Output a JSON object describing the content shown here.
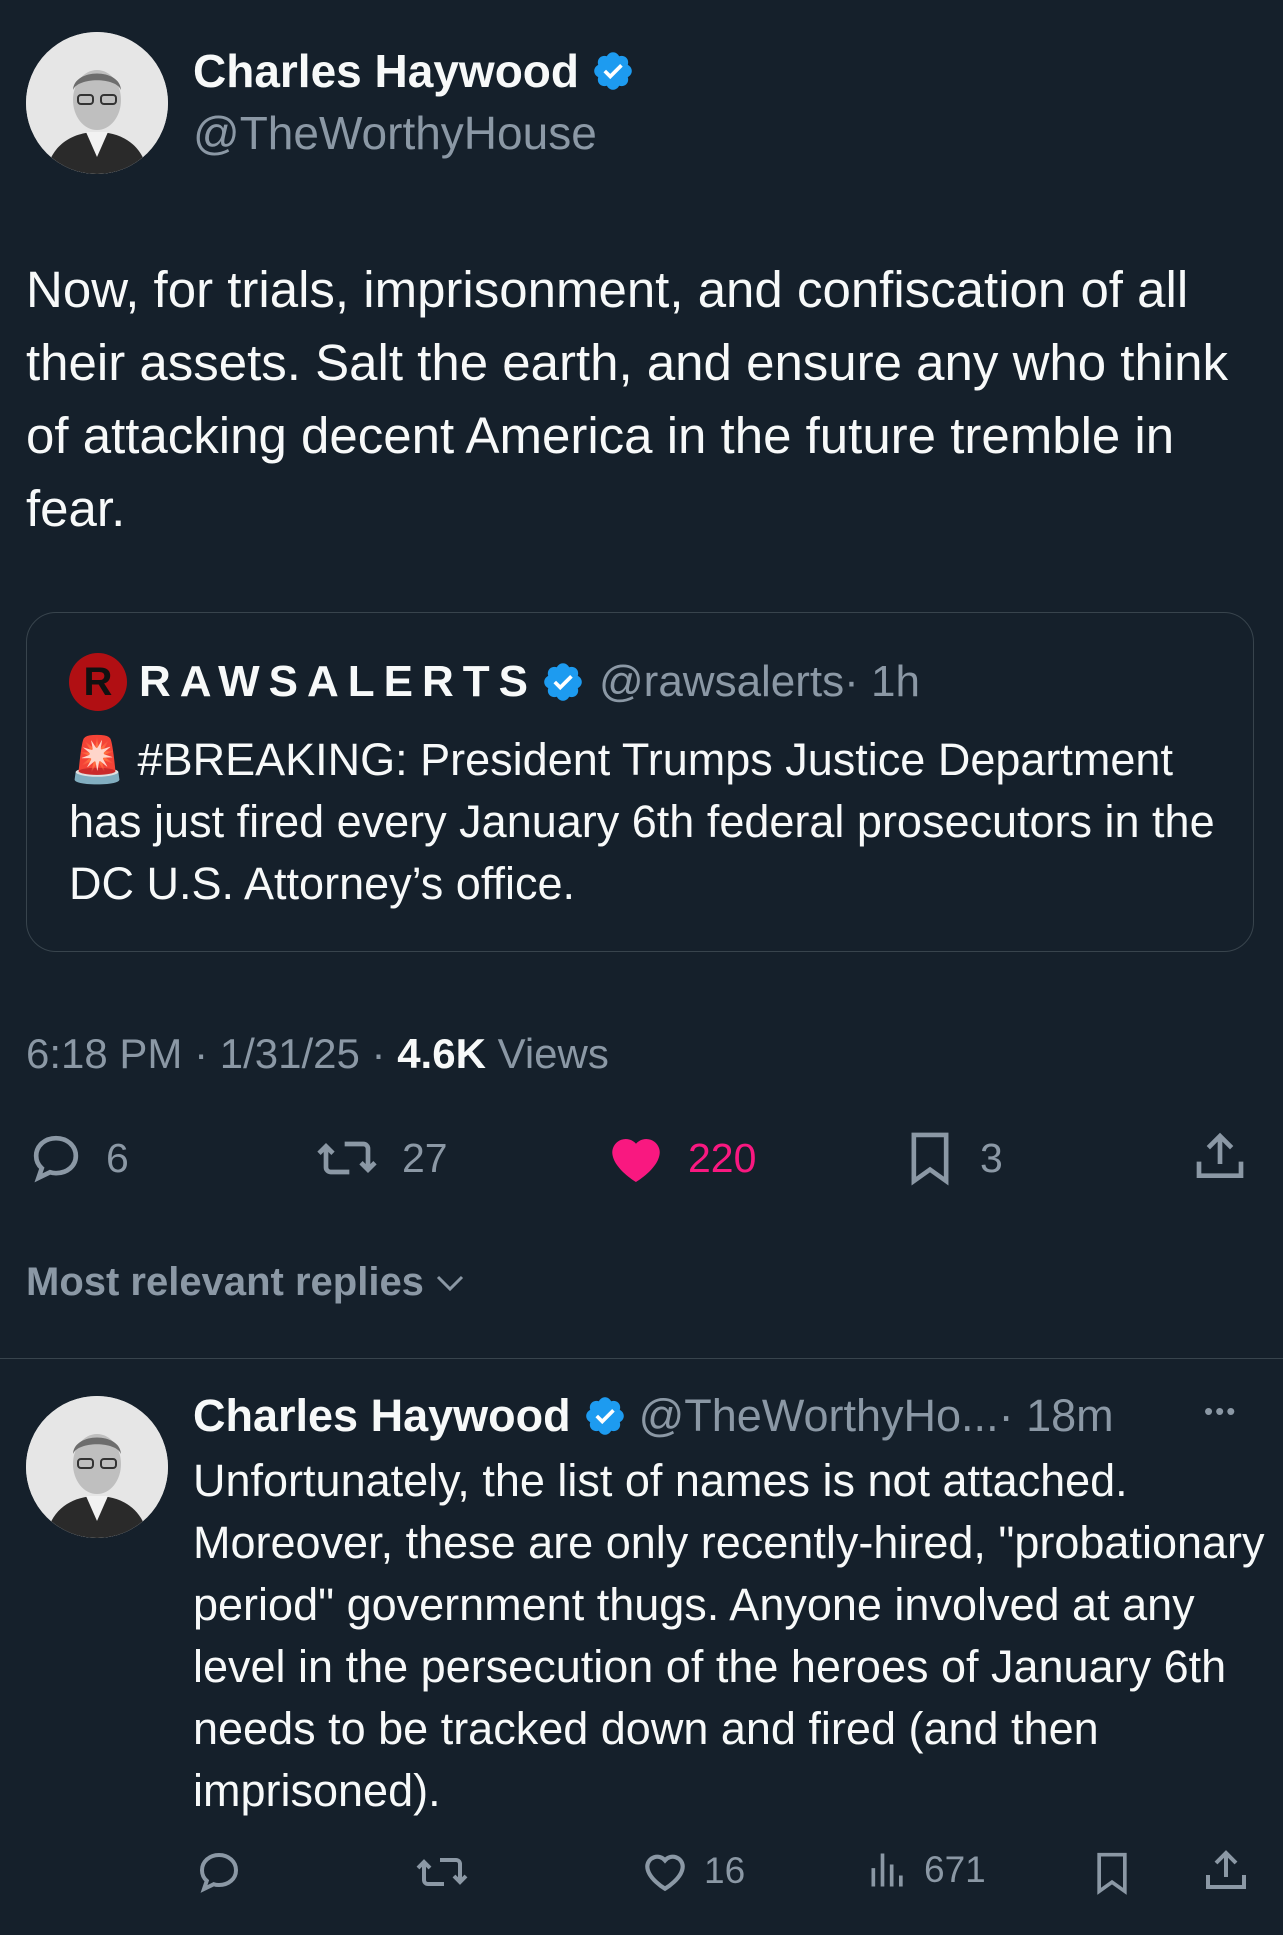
{
  "main_tweet": {
    "author_name": "Charles Haywood",
    "handle": "@TheWorthyHouse",
    "text": "Now, for trials, imprisonment, and confiscation of all their assets. Salt the earth, and ensure any who think of attacking decent America in the future tremble in fear.",
    "timestamp": "6:18 PM · 1/31/25 · ",
    "views_count": "4.6K",
    "views_label": " Views",
    "stats": {
      "replies": "6",
      "reposts": "27",
      "likes": "220",
      "bookmarks": "3"
    }
  },
  "quote_tweet": {
    "author_name": "RAWSALERTS",
    "handle": "@rawsalerts",
    "time": " · 1h",
    "emoji": "🚨",
    "text": "#BREAKING: President Trumps Justice Department has just fired every January 6th federal prosecutors in the DC U.S. Attorney’s office."
  },
  "replies_header": "Most relevant replies",
  "reply": {
    "author_name": "Charles Haywood",
    "handle": "@TheWorthyHo...",
    "time": " · 18m",
    "more": "•••",
    "text": "Unfortunately, the list of names is not attached. Moreover, these are only recently-hired, \"probationary period\" government thugs.  Anyone involved at any level in the persecution of the heroes of January 6th needs to be tracked down and fired (and then imprisoned).",
    "stats": {
      "likes": "16",
      "views": "671"
    }
  },
  "colors": {
    "background": "#15202b",
    "accent": "#1d9bf0",
    "like": "#f91880",
    "muted": "#8b98a5"
  }
}
